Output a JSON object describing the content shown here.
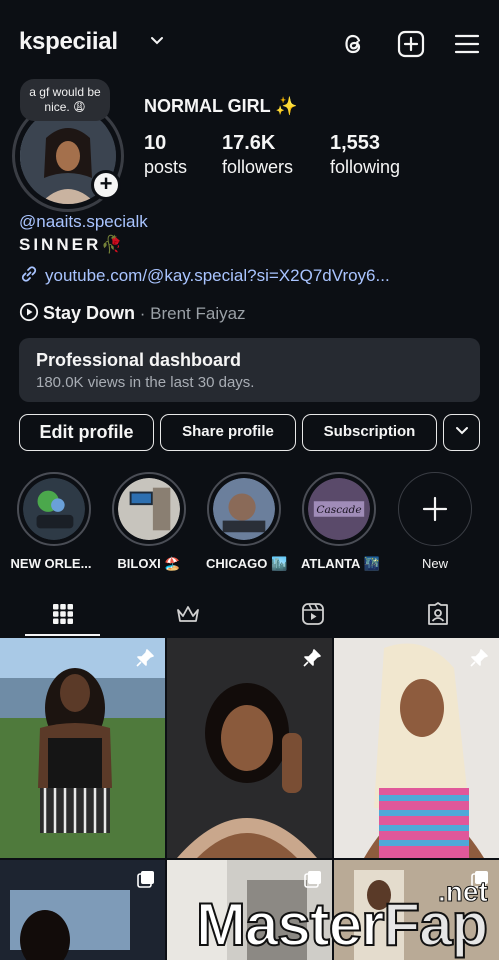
{
  "header": {
    "username": "kspeciial"
  },
  "note": {
    "text": "a gf would be nice. 😩"
  },
  "profile": {
    "name": "NORMAL GIRL ✨",
    "stats": [
      {
        "value": "10",
        "label": "posts"
      },
      {
        "value": "17.6K",
        "label": "followers"
      },
      {
        "value": "1,553",
        "label": "following"
      }
    ],
    "handle": "@naaits.specialk",
    "bio": "SINNER🥀",
    "link": "youtube.com/@kay.special?si=X2Q7dVroy6...",
    "music": {
      "song": "Stay Down",
      "separator": " · ",
      "artist": "Brent Faiyaz"
    }
  },
  "dashboard": {
    "title": "Professional dashboard",
    "subtitle": "180.0K views in the last 30 days."
  },
  "buttons": {
    "edit": "Edit profile",
    "share": "Share profile",
    "subscription": "Subscription"
  },
  "highlights": [
    {
      "label": "NEW ORLE..."
    },
    {
      "label": "BILOXI 🏖️"
    },
    {
      "label": "CHICAGO 🏙️"
    },
    {
      "label": "ATLANTA 🌃"
    },
    {
      "label": "New"
    }
  ],
  "highlight_text": {
    "atlanta_cover": "Cascade"
  },
  "tabs": [
    "grid-icon",
    "crown-icon",
    "reels-icon",
    "tagged-icon"
  ],
  "watermark": {
    "main": "Master",
    "accent": "Fap",
    "domain": ".net"
  },
  "colors": {
    "background": "#0c0f14",
    "link": "#a9c4ff",
    "card": "#262a31"
  }
}
